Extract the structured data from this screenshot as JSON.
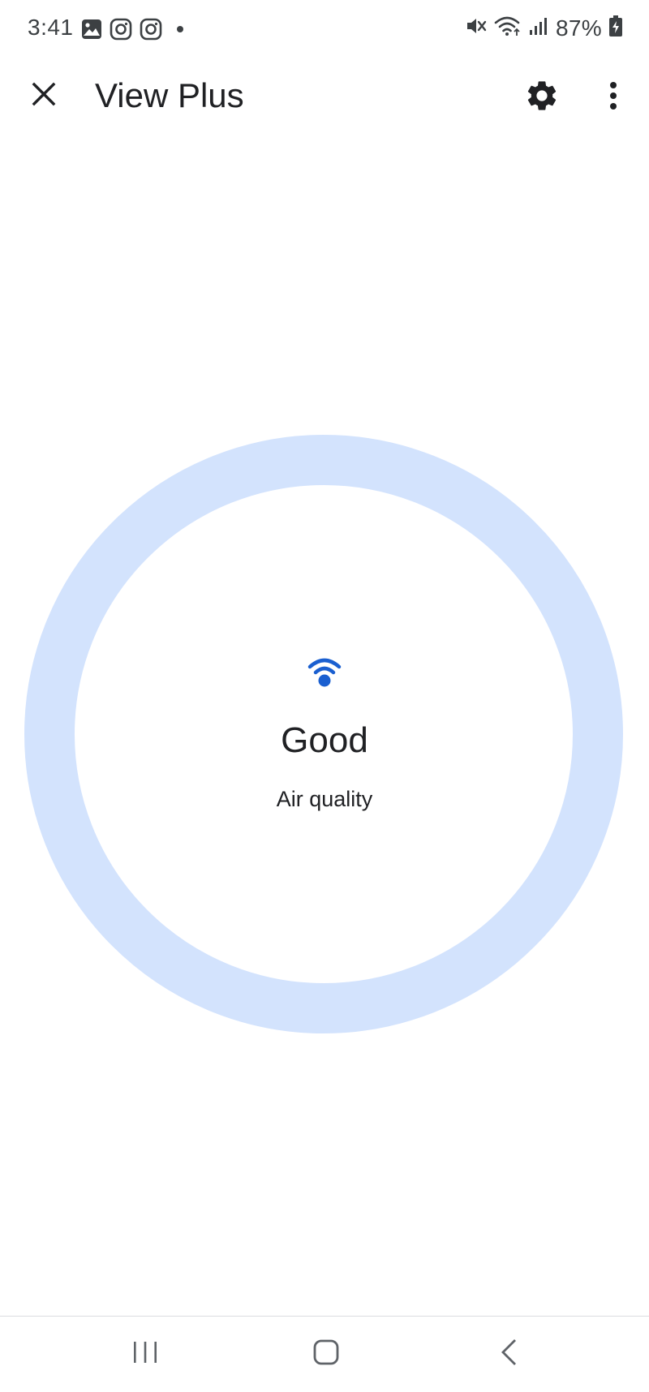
{
  "status_bar": {
    "time": "3:41",
    "left_icons": [
      "gallery-notification-icon",
      "instagram-notification-icon",
      "instagram-notification-icon",
      "more-notifications-dot-icon"
    ],
    "right_icons": [
      "mute-icon",
      "wifi-icon",
      "cellular-signal-icon",
      "battery-charging-icon"
    ],
    "battery_percent": "87%"
  },
  "app_bar": {
    "title": "View Plus",
    "close_icon": "close-icon",
    "settings_icon": "gear-icon",
    "more_icon": "more-vert-icon"
  },
  "air_quality": {
    "value": "Good",
    "label": "Air quality",
    "icon": "air-quality-signal-icon",
    "ring_color": "#d3e3fd",
    "icon_color": "#1a5fd0"
  },
  "nav_bar": {
    "recents_icon": "recents-icon",
    "home_icon": "home-icon",
    "back_icon": "back-icon"
  }
}
